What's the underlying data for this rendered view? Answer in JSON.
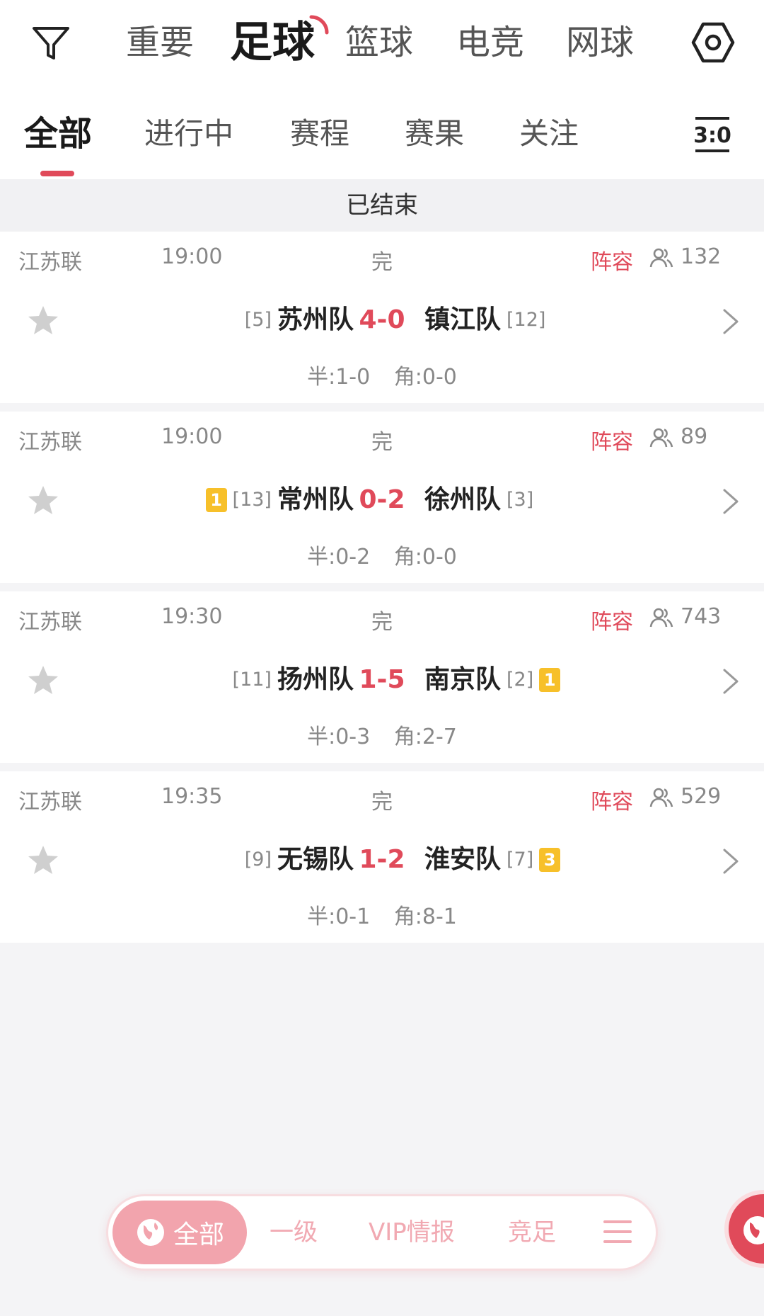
{
  "sport_tabs": [
    {
      "label": "重要",
      "active": false
    },
    {
      "label": "足球",
      "active": true
    },
    {
      "label": "篮球",
      "active": false
    },
    {
      "label": "电竞",
      "active": false
    },
    {
      "label": "网球",
      "active": false
    }
  ],
  "sub_tabs": [
    {
      "label": "全部",
      "active": true
    },
    {
      "label": "进行中",
      "active": false
    },
    {
      "label": "赛程",
      "active": false
    },
    {
      "label": "赛果",
      "active": false
    },
    {
      "label": "关注",
      "active": false
    }
  ],
  "score_icon_text": "3:0",
  "section_title": "已结束",
  "matches": [
    {
      "league": "江苏联",
      "time": "19:00",
      "status": "完",
      "lineup_label": "阵容",
      "views": "132",
      "home": {
        "name": "苏州队",
        "rank": "[5]",
        "card": ""
      },
      "score": "4-0",
      "away": {
        "name": "镇江队",
        "rank": "[12]",
        "card": ""
      },
      "half": "半:1-0",
      "corner": "角:0-0"
    },
    {
      "league": "江苏联",
      "time": "19:00",
      "status": "完",
      "lineup_label": "阵容",
      "views": "89",
      "home": {
        "name": "常州队",
        "rank": "[13]",
        "card": "1"
      },
      "score": "0-2",
      "away": {
        "name": "徐州队",
        "rank": "[3]",
        "card": ""
      },
      "half": "半:0-2",
      "corner": "角:0-0"
    },
    {
      "league": "江苏联",
      "time": "19:30",
      "status": "完",
      "lineup_label": "阵容",
      "views": "743",
      "home": {
        "name": "扬州队",
        "rank": "[11]",
        "card": ""
      },
      "score": "1-5",
      "away": {
        "name": "南京队",
        "rank": "[2]",
        "card": "1"
      },
      "half": "半:0-3",
      "corner": "角:2-7"
    },
    {
      "league": "江苏联",
      "time": "19:35",
      "status": "完",
      "lineup_label": "阵容",
      "views": "529",
      "home": {
        "name": "无锡队",
        "rank": "[9]",
        "card": ""
      },
      "score": "1-2",
      "away": {
        "name": "淮安队",
        "rank": "[7]",
        "card": "3"
      },
      "half": "半:0-1",
      "corner": "角:8-1"
    }
  ],
  "bottom_bar": {
    "all_label": "全部",
    "items": [
      "一级",
      "VIP情报",
      "竞足"
    ]
  },
  "icons": {
    "filter": "filter-icon",
    "settings": "settings-icon",
    "score": "score-icon",
    "people": "people-icon",
    "star": "star-icon",
    "chevron": "chevron-right-icon",
    "globe": "globe-icon",
    "menu": "menu-icon"
  },
  "colors": {
    "accent": "#e04a5a",
    "card_yellow": "#f7c02a",
    "muted_pink": "#f2a4ad"
  }
}
